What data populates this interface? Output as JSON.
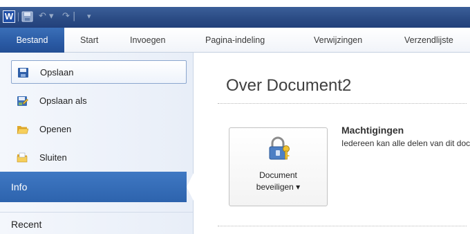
{
  "titlebar": {
    "app_icon": "W",
    "qat": {
      "save_icon": "save-icon",
      "undo_glyph": "↶ ▾",
      "redo_glyph": "↷ |",
      "customize_glyph": "▾"
    }
  },
  "ribbon": {
    "tabs": [
      {
        "label": "Bestand"
      },
      {
        "label": "Start"
      },
      {
        "label": "Invoegen"
      },
      {
        "label": "Pagina-indeling"
      },
      {
        "label": "Verwijzingen"
      },
      {
        "label": "Verzendlijste"
      }
    ]
  },
  "backstage": {
    "commands": [
      {
        "label": "Opslaan",
        "icon": "save-icon"
      },
      {
        "label": "Opslaan als",
        "icon": "save-as-icon"
      },
      {
        "label": "Openen",
        "icon": "open-folder-icon"
      },
      {
        "label": "Sluiten",
        "icon": "close-folder-icon"
      }
    ],
    "info_label": "Info",
    "recent_label": "Recent"
  },
  "main": {
    "title": "Over Document2",
    "protect_button": {
      "line1": "Document",
      "line2": "beveiligen ▾",
      "icon": "lock-key-icon"
    },
    "permissions": {
      "title": "Machtigingen",
      "description": "Iedereen kan alle delen van dit document"
    }
  },
  "colors": {
    "title_bar": "#2b4c85",
    "file_tab": "#2a5aa4",
    "info_selected": "#3a70bb"
  }
}
